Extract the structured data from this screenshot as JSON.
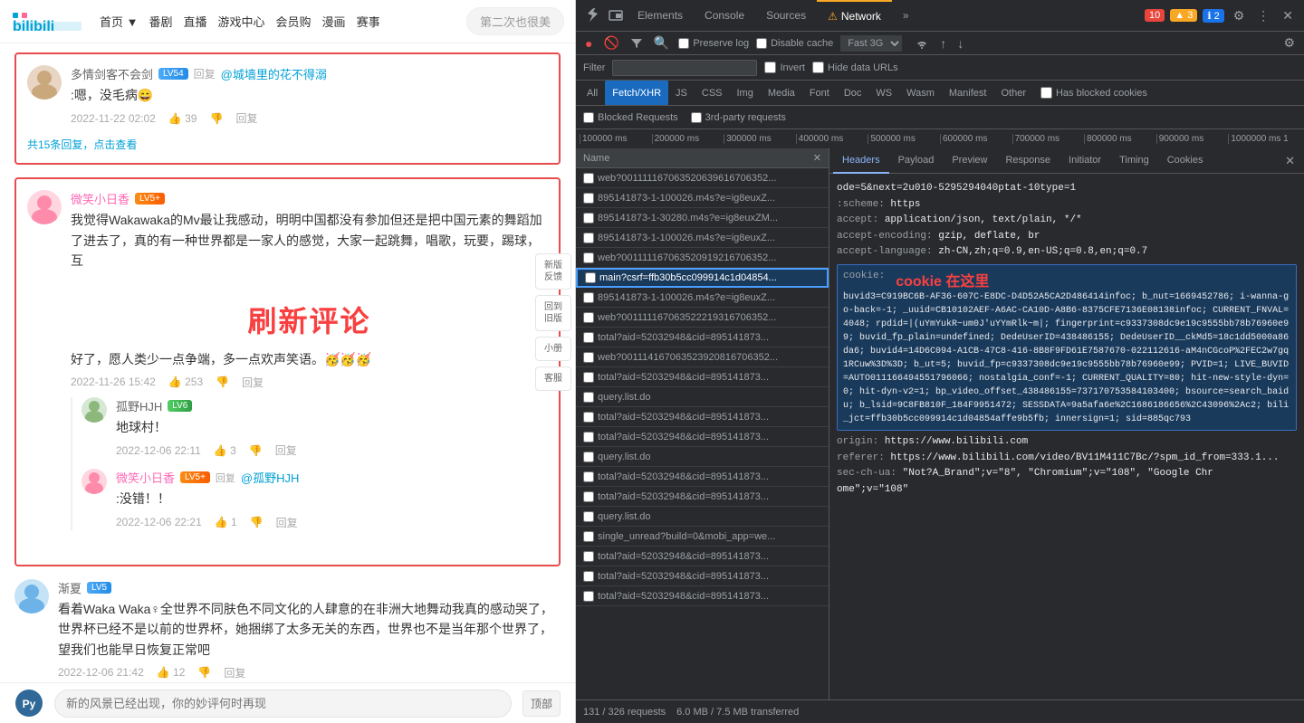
{
  "bilibili": {
    "logo_text": "bilibili",
    "nav_items": [
      "首页▼",
      "番剧",
      "直播",
      "游戏中心",
      "会员购",
      "漫画",
      "赛事"
    ],
    "search_placeholder": "第二次也很美",
    "comments": [
      {
        "id": 1,
        "username": "多情剑客不会剑",
        "level": "LV54",
        "reply_to": "@城墙里的花不得溺",
        "text": ":嗯，没毛病😄",
        "date": "2022-11-22 02:02",
        "likes": "39",
        "is_reply": true
      }
    ],
    "see_more": "共15条回复，点击查看",
    "main_comment": {
      "username": "微笑小日香",
      "level": "LV5+",
      "text1": "我觉得Wakawaka的Mv最让我感动，明明中国都没有参加但还是把中国元素的舞蹈加了进去了，真的有一种世界都是一家人的感觉，大家一起跳舞，唱歌，玩要，踢球，互",
      "text2": "好了，愿人类少一点争端，多一点欢声笑语。🥳🥳🥳",
      "date": "2022-11-26 15:42",
      "likes": "253",
      "refresh_text": "刷新评论"
    },
    "comment2": {
      "username": "孤野HJH",
      "level": "LV6",
      "text": "地球村！",
      "date": "2022-12-06 22:11",
      "likes": "3"
    },
    "comment3": {
      "username": "微笑小日香",
      "level": "LV5+",
      "reply_to": "@孤野HJH",
      "text": ":没错！！",
      "date": "2022-12-06 22:21",
      "likes": "1"
    },
    "comment4": {
      "username": "渐夏",
      "level": "LV5",
      "text1": "看着Waka Waka♀全世界不同肤色不同文化的人肆意的在非洲大地舞动我真的感动哭了，世界杯已经不是以前的世界杯，她捆绑了太多无关的东西，世界也不是当年那个世界了，",
      "text2": "望我们也能早日恢复正常吧",
      "date": "2022-12-06 21:42",
      "likes": "12"
    },
    "float_btns": [
      "新版\n反馈",
      "回到\n旧版",
      "小册",
      "客服"
    ],
    "bottom_input_placeholder": "新的风景已经出现，你的妙评何时再现",
    "top_btn": "顶部"
  },
  "devtools": {
    "tabs": [
      {
        "label": "Elements",
        "active": false
      },
      {
        "label": "Console",
        "active": false
      },
      {
        "label": "Sources",
        "active": false
      },
      {
        "label": "Network",
        "active": true
      },
      {
        "label": "»",
        "active": false
      }
    ],
    "badges": {
      "error_count": "10",
      "warn_count": "3",
      "warn2_count": "2"
    },
    "toolbar": {
      "preserve_log": "Preserve log",
      "disable_cache": "Disable cache",
      "fast3g": "Fast 3G"
    },
    "filter": {
      "label": "Filter",
      "invert": "Invert",
      "hide_data": "Hide data URLs"
    },
    "type_tabs": [
      "All",
      "Fetch/XHR",
      "JS",
      "CSS",
      "Img",
      "Media",
      "Font",
      "Doc",
      "WS",
      "Wasm",
      "Manifest",
      "Other"
    ],
    "active_type": "Fetch/XHR",
    "extra_filters": {
      "blocked": "Has blocked cookies",
      "blocked_req": "Blocked Requests",
      "third_party": "3rd-party requests"
    },
    "timeline": {
      "marks": [
        "100000 ms",
        "200000 ms",
        "300000 ms",
        "400000 ms",
        "500000 ms",
        "600000 ms",
        "700000 ms",
        "800000 ms",
        "900000 ms",
        "1000000 ms 1"
      ]
    },
    "requests": [
      {
        "name": "web?00111116706352063961670635 2...",
        "selected": false
      },
      {
        "name": "895141873-1-100026.m4s?e=ig8euxZ...",
        "selected": false
      },
      {
        "name": "895141873-1-30280.m4s?e=ig8euxZM...",
        "selected": false
      },
      {
        "name": "895141873-1-100026.m4s?e=ig8euxZ...",
        "selected": false
      },
      {
        "name": "web?001111167063520919216706352...",
        "selected": false
      },
      {
        "name": "main?csrf=ffb30b5cc099914c1d04854...",
        "selected": true
      },
      {
        "name": "895141873-1-100026.m4s?e=ig8euxZ...",
        "selected": false
      },
      {
        "name": "web?001111167063522219316706352...",
        "selected": false
      },
      {
        "name": "total?aid=52032948&cid=895141873...",
        "selected": false
      },
      {
        "name": "web?001114167063523920816706352...",
        "selected": false
      },
      {
        "name": "total?aid=52032948&cid=895141873...",
        "selected": false
      },
      {
        "name": "query.list.do",
        "selected": false
      },
      {
        "name": "total?aid=52032948&cid=895141873...",
        "selected": false
      },
      {
        "name": "total?aid=52032948&cid=895141873...",
        "selected": false
      },
      {
        "name": "query.list.do",
        "selected": false
      },
      {
        "name": "total?aid=52032948&cid=895141873...",
        "selected": false
      },
      {
        "name": "total?aid=52032948&cid=895141873...",
        "selected": false
      },
      {
        "name": "query.list.do",
        "selected": false
      },
      {
        "name": "single_unread?build=0&mobi_app=we...",
        "selected": false
      },
      {
        "name": "total?aid=52032948&cid=895141873...",
        "selected": false
      },
      {
        "name": "total?aid=52032948&cid=895141873...",
        "selected": false
      },
      {
        "name": "total?aid=52032948&cid=895141873...",
        "selected": false
      }
    ],
    "details": {
      "tabs": [
        "Headers",
        "Payload",
        "Preview",
        "Response",
        "Initiator",
        "Timing",
        "Cookies"
      ],
      "active_tab": "Headers",
      "headers": [
        {
          "key": "",
          "value": "ode=5&next=2u010-5295294040ptat-10type=1"
        },
        {
          "key": ":scheme:",
          "value": "https"
        },
        {
          "key": "accept:",
          "value": "application/json, text/plain, */*"
        },
        {
          "key": "accept-encoding:",
          "value": "gzip, deflate, br"
        },
        {
          "key": "accept-language:",
          "value": "zh-CN,zh;q=0.9,en-US;q=0.8,en;q=0.7"
        }
      ],
      "cookie_value": "buvid3=C919BC6B-AF36-607C-E8DC-D4D52A5CA2D486414infoc; b_nut=1669452786; i-wanna-go-back=-1; _uuid=CB10102AEF-A6AC-CA10D-A8B6-8375CFE7136E08138infoc; CURRENT_FNVAL=4048; rpdid=|(uYmYukR~um0J'uYYmRlk~m|; fingerprint=c9337308dc9e19c9555bb78b76960e99; buvid_fp_plain=undefined; DedeUserID=438486155; DedeUserID__ckMd5=18c1dd5000a86da6; buvid4=14D6C094-A1CB-47C8-416-8B8F9FD61E7587670-022112616-aM4nCGcoP%2FEC2w7gq1RCuw%3D%3D; b_ut=5; buvid_fp=c9337308dc9e19c9555bb78b76960e99; PVID=1; LIVE_BUVID=AUTO011166494551796066; nostalgia_conf=-1; CURRENT_QUALITY=80; hit-new-style-dyn=0; hit-dyn-v2=1; bp_video_offset_438486155=737170753584103400; bsource=search_baidu; b_lsid=9C8FB810F_184F9951472; SESSDATA=9a5afa6e%2C1686186656%2C43096%2Ac2; bili_jct=ffb30b5cc099914c1d04854affe9b5fb; innersign=1; sid=885qc793",
      "cookie_label": "cookie 在这里",
      "origin": "https://www.bilibili.com",
      "referer": "https://www.bilibili.com/video/BV11M411C7Bc/?spm_id_from=333.1...",
      "sec_ch_ua": "\"Not?A_Brand\";v=\"8\", \"Chromium\";v=\"108\", \"Google Chr...ome\";v=\"108\""
    },
    "status": {
      "requests": "131 / 326 requests",
      "size": "6.0 MB / 7.5 MB transferred"
    }
  }
}
